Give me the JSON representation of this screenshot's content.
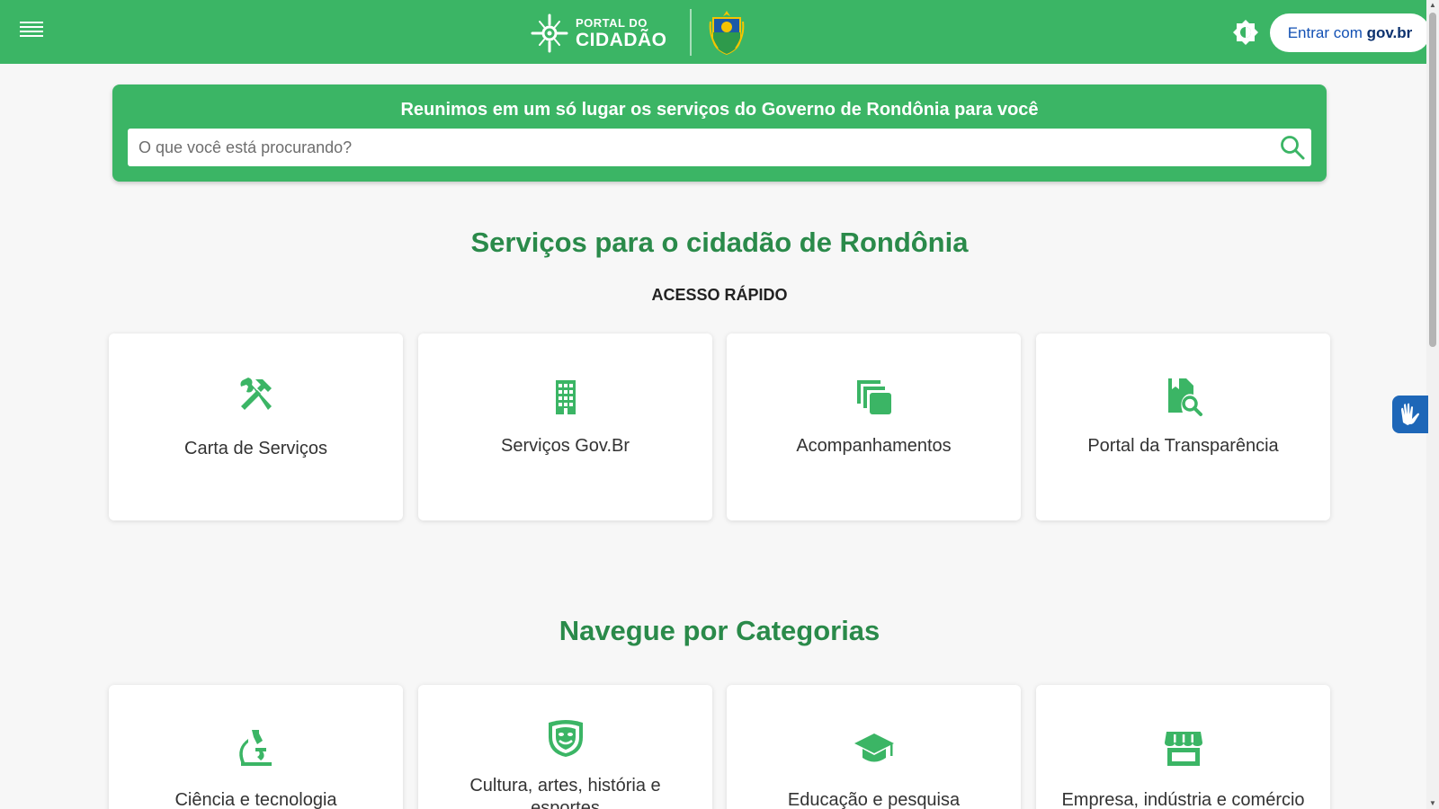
{
  "header": {
    "brand_small": "PORTAL DO",
    "brand_big": "CIDADÃO",
    "login_prefix": "Entrar com ",
    "login_bold": "gov.br",
    "icons": [
      "menu-icon",
      "portal-logo-icon",
      "rondonia-crest-icon",
      "contrast-icon"
    ]
  },
  "hero": {
    "title": "Reunimos em um só lugar os serviços do Governo de Rondônia para você",
    "search_placeholder": "O que você está procurando?",
    "search_value": ""
  },
  "services": {
    "title": "Serviços para o cidadão de Rondônia",
    "subtitle": "ACESSO RÁPIDO",
    "cards": [
      {
        "label": "Carta de Serviços",
        "icon": "tools-icon"
      },
      {
        "label": "Serviços Gov.Br",
        "icon": "building-icon"
      },
      {
        "label": "Acompanhamentos",
        "icon": "copies-icon"
      },
      {
        "label": "Portal da Transparência",
        "icon": "document-search-icon"
      }
    ]
  },
  "categories": {
    "title": "Navegue por Categorias",
    "cards": [
      {
        "label": "Ciência e tecnologia",
        "icon": "microscope-icon"
      },
      {
        "label": "Cultura, artes, história e esportes",
        "icon": "theater-mask-icon"
      },
      {
        "label": "Educação e pesquisa",
        "icon": "graduation-cap-icon"
      },
      {
        "label": "Empresa, indústria e comércio",
        "icon": "storefront-icon"
      }
    ]
  },
  "colors": {
    "primary_green": "#3bb565",
    "heading_green": "#2a8a4a",
    "govbr_blue": "#1351b4"
  }
}
